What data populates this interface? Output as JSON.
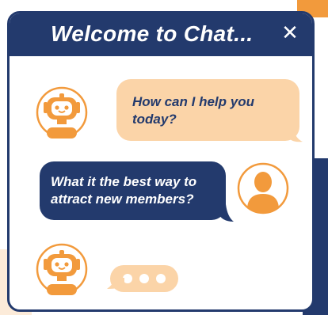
{
  "window": {
    "title": "Welcome to Chat...",
    "close_icon": "close-icon"
  },
  "messages": [
    {
      "sender": "bot",
      "text": "How can I help you today?"
    },
    {
      "sender": "user",
      "text": "What it the best way to attract new members?"
    },
    {
      "sender": "bot",
      "typing": true
    }
  ],
  "colors": {
    "navy": "#233a6d",
    "orange": "#f29a3c",
    "peach": "#fbd4a8",
    "light_peach": "#fcebd9"
  }
}
